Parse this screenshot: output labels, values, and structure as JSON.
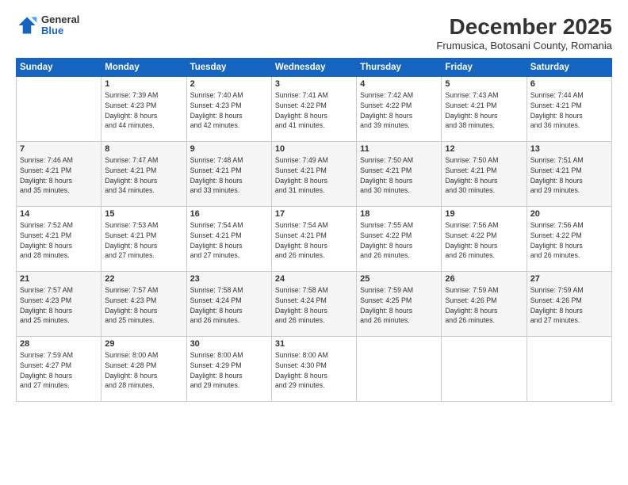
{
  "logo": {
    "general": "General",
    "blue": "Blue"
  },
  "header": {
    "month": "December 2025",
    "location": "Frumusica, Botosani County, Romania"
  },
  "days_of_week": [
    "Sunday",
    "Monday",
    "Tuesday",
    "Wednesday",
    "Thursday",
    "Friday",
    "Saturday"
  ],
  "weeks": [
    [
      {
        "day": "",
        "info": ""
      },
      {
        "day": "1",
        "info": "Sunrise: 7:39 AM\nSunset: 4:23 PM\nDaylight: 8 hours\nand 44 minutes."
      },
      {
        "day": "2",
        "info": "Sunrise: 7:40 AM\nSunset: 4:23 PM\nDaylight: 8 hours\nand 42 minutes."
      },
      {
        "day": "3",
        "info": "Sunrise: 7:41 AM\nSunset: 4:22 PM\nDaylight: 8 hours\nand 41 minutes."
      },
      {
        "day": "4",
        "info": "Sunrise: 7:42 AM\nSunset: 4:22 PM\nDaylight: 8 hours\nand 39 minutes."
      },
      {
        "day": "5",
        "info": "Sunrise: 7:43 AM\nSunset: 4:21 PM\nDaylight: 8 hours\nand 38 minutes."
      },
      {
        "day": "6",
        "info": "Sunrise: 7:44 AM\nSunset: 4:21 PM\nDaylight: 8 hours\nand 36 minutes."
      }
    ],
    [
      {
        "day": "7",
        "info": "Sunrise: 7:46 AM\nSunset: 4:21 PM\nDaylight: 8 hours\nand 35 minutes."
      },
      {
        "day": "8",
        "info": "Sunrise: 7:47 AM\nSunset: 4:21 PM\nDaylight: 8 hours\nand 34 minutes."
      },
      {
        "day": "9",
        "info": "Sunrise: 7:48 AM\nSunset: 4:21 PM\nDaylight: 8 hours\nand 33 minutes."
      },
      {
        "day": "10",
        "info": "Sunrise: 7:49 AM\nSunset: 4:21 PM\nDaylight: 8 hours\nand 31 minutes."
      },
      {
        "day": "11",
        "info": "Sunrise: 7:50 AM\nSunset: 4:21 PM\nDaylight: 8 hours\nand 30 minutes."
      },
      {
        "day": "12",
        "info": "Sunrise: 7:50 AM\nSunset: 4:21 PM\nDaylight: 8 hours\nand 30 minutes."
      },
      {
        "day": "13",
        "info": "Sunrise: 7:51 AM\nSunset: 4:21 PM\nDaylight: 8 hours\nand 29 minutes."
      }
    ],
    [
      {
        "day": "14",
        "info": "Sunrise: 7:52 AM\nSunset: 4:21 PM\nDaylight: 8 hours\nand 28 minutes."
      },
      {
        "day": "15",
        "info": "Sunrise: 7:53 AM\nSunset: 4:21 PM\nDaylight: 8 hours\nand 27 minutes."
      },
      {
        "day": "16",
        "info": "Sunrise: 7:54 AM\nSunset: 4:21 PM\nDaylight: 8 hours\nand 27 minutes."
      },
      {
        "day": "17",
        "info": "Sunrise: 7:54 AM\nSunset: 4:21 PM\nDaylight: 8 hours\nand 26 minutes."
      },
      {
        "day": "18",
        "info": "Sunrise: 7:55 AM\nSunset: 4:22 PM\nDaylight: 8 hours\nand 26 minutes."
      },
      {
        "day": "19",
        "info": "Sunrise: 7:56 AM\nSunset: 4:22 PM\nDaylight: 8 hours\nand 26 minutes."
      },
      {
        "day": "20",
        "info": "Sunrise: 7:56 AM\nSunset: 4:22 PM\nDaylight: 8 hours\nand 26 minutes."
      }
    ],
    [
      {
        "day": "21",
        "info": "Sunrise: 7:57 AM\nSunset: 4:23 PM\nDaylight: 8 hours\nand 25 minutes."
      },
      {
        "day": "22",
        "info": "Sunrise: 7:57 AM\nSunset: 4:23 PM\nDaylight: 8 hours\nand 25 minutes."
      },
      {
        "day": "23",
        "info": "Sunrise: 7:58 AM\nSunset: 4:24 PM\nDaylight: 8 hours\nand 26 minutes."
      },
      {
        "day": "24",
        "info": "Sunrise: 7:58 AM\nSunset: 4:24 PM\nDaylight: 8 hours\nand 26 minutes."
      },
      {
        "day": "25",
        "info": "Sunrise: 7:59 AM\nSunset: 4:25 PM\nDaylight: 8 hours\nand 26 minutes."
      },
      {
        "day": "26",
        "info": "Sunrise: 7:59 AM\nSunset: 4:26 PM\nDaylight: 8 hours\nand 26 minutes."
      },
      {
        "day": "27",
        "info": "Sunrise: 7:59 AM\nSunset: 4:26 PM\nDaylight: 8 hours\nand 27 minutes."
      }
    ],
    [
      {
        "day": "28",
        "info": "Sunrise: 7:59 AM\nSunset: 4:27 PM\nDaylight: 8 hours\nand 27 minutes."
      },
      {
        "day": "29",
        "info": "Sunrise: 8:00 AM\nSunset: 4:28 PM\nDaylight: 8 hours\nand 28 minutes."
      },
      {
        "day": "30",
        "info": "Sunrise: 8:00 AM\nSunset: 4:29 PM\nDaylight: 8 hours\nand 29 minutes."
      },
      {
        "day": "31",
        "info": "Sunrise: 8:00 AM\nSunset: 4:30 PM\nDaylight: 8 hours\nand 29 minutes."
      },
      {
        "day": "",
        "info": ""
      },
      {
        "day": "",
        "info": ""
      },
      {
        "day": "",
        "info": ""
      }
    ]
  ]
}
